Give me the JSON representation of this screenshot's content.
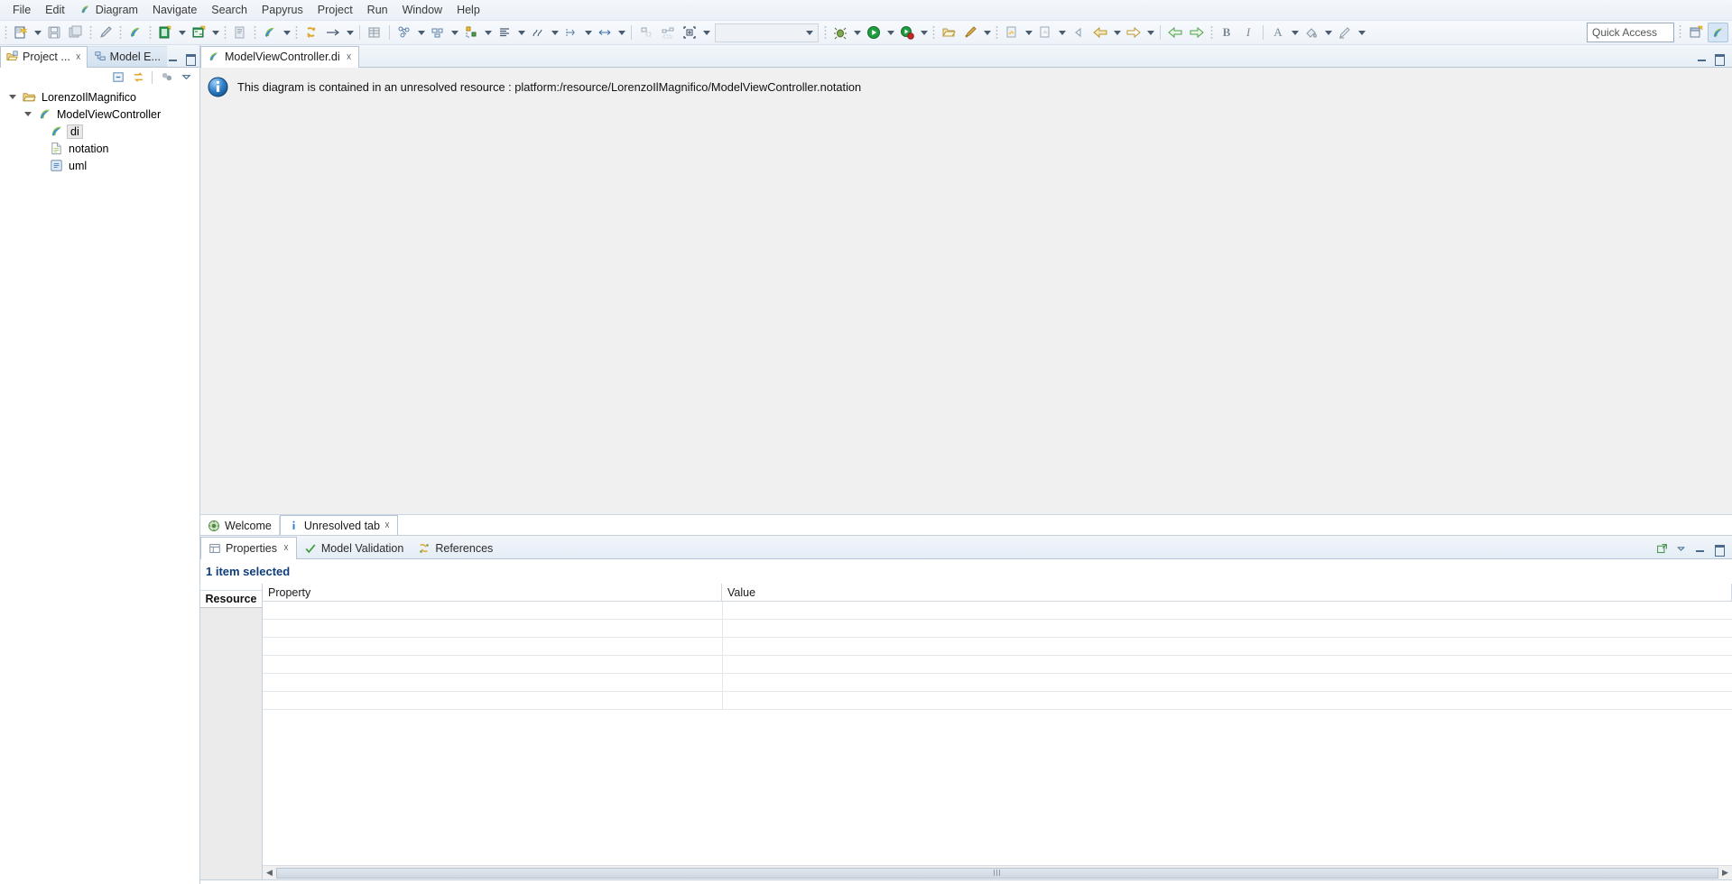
{
  "menubar": {
    "items": [
      {
        "label": "File",
        "icon": null
      },
      {
        "label": "Edit",
        "icon": null
      },
      {
        "label": "Diagram",
        "icon": "papyrus-icon"
      },
      {
        "label": "Navigate",
        "icon": null
      },
      {
        "label": "Search",
        "icon": null
      },
      {
        "label": "Papyrus",
        "icon": null
      },
      {
        "label": "Project",
        "icon": null
      },
      {
        "label": "Run",
        "icon": null
      },
      {
        "label": "Window",
        "icon": null
      },
      {
        "label": "Help",
        "icon": null
      }
    ]
  },
  "toolbar": {
    "quick_access_placeholder": "Quick Access",
    "combo1_value": "",
    "combo2_value": "",
    "buttons": [
      {
        "name": "new-wizard",
        "title": "New"
      },
      {
        "name": "save",
        "title": "Save"
      },
      {
        "name": "save-all",
        "title": "Save All"
      },
      {
        "name": "print",
        "title": "Print"
      },
      {
        "name": "papyrus-perspective",
        "title": "Papyrus"
      },
      {
        "name": "new-model",
        "title": "New Model"
      },
      {
        "name": "new-diagram",
        "title": "New Diagram"
      },
      {
        "name": "paste-style",
        "title": "Copy Style"
      },
      {
        "name": "papyrus-model",
        "title": "Papyrus Model"
      },
      {
        "name": "refresh-link",
        "title": "Refresh"
      },
      {
        "name": "arrow-tool",
        "title": "Arrow"
      },
      {
        "name": "table-tool",
        "title": "Table"
      },
      {
        "name": "filter-nodes",
        "title": "Filter"
      },
      {
        "name": "align-nodes",
        "title": "Align"
      },
      {
        "name": "distribute-nodes",
        "title": "Distribute"
      },
      {
        "name": "align-text",
        "title": "Align Text"
      },
      {
        "name": "route-links",
        "title": "Routing"
      },
      {
        "name": "resize-links",
        "title": "Link Style"
      },
      {
        "name": "snap-size",
        "title": "Size"
      },
      {
        "name": "arrange-selection",
        "title": "Arrange Selection"
      },
      {
        "name": "arrange-all",
        "title": "Arrange All"
      },
      {
        "name": "zoom-fit",
        "title": "Zoom to Fit"
      },
      {
        "name": "debug",
        "title": "Debug"
      },
      {
        "name": "run",
        "title": "Run"
      },
      {
        "name": "coverage",
        "title": "Coverage"
      },
      {
        "name": "open-type",
        "title": "Open Type"
      },
      {
        "name": "search-ref",
        "title": "Search"
      },
      {
        "name": "next-annotation",
        "title": "Next Annotation"
      },
      {
        "name": "last-edit",
        "title": "Last Edit Location"
      },
      {
        "name": "back-nav",
        "title": "Back"
      },
      {
        "name": "forward-nav",
        "title": "Forward"
      },
      {
        "name": "prev-page",
        "title": "Previous"
      },
      {
        "name": "next-page",
        "title": "Next"
      },
      {
        "name": "bold",
        "title": "B"
      },
      {
        "name": "italic",
        "title": "I"
      },
      {
        "name": "font-color",
        "title": "A"
      },
      {
        "name": "fill-color",
        "title": "Fill Color"
      },
      {
        "name": "line-color",
        "title": "Line Color"
      }
    ],
    "format_bold_label": "B",
    "format_italic_label": "I",
    "format_font_label": "A"
  },
  "left_panel": {
    "tabs": [
      {
        "label": "Project ...",
        "icon": "project-explorer-icon",
        "active": true,
        "closable": true
      },
      {
        "label": "Model E...",
        "icon": "model-explorer-icon",
        "active": false,
        "closable": false
      }
    ],
    "view_toolbar": [
      {
        "name": "collapse-all-button",
        "icon": "collapse-all-icon"
      },
      {
        "name": "link-with-editor-button",
        "icon": "link-editor-icon"
      },
      {
        "name": "focus-on-active-task-button",
        "icon": "focus-task-icon"
      },
      {
        "name": "view-menu-button",
        "icon": "view-menu-icon"
      }
    ],
    "tree": [
      {
        "label": "LorenzoIlMagnifico",
        "icon": "project-folder-icon",
        "depth": 0,
        "expanded": true,
        "selected": false
      },
      {
        "label": "ModelViewController",
        "icon": "papyrus-model-icon",
        "depth": 1,
        "expanded": true,
        "selected": false
      },
      {
        "label": "di",
        "icon": "papyrus-di-icon",
        "depth": 2,
        "expanded": null,
        "selected": true
      },
      {
        "label": "notation",
        "icon": "notation-file-icon",
        "depth": 2,
        "expanded": null,
        "selected": false
      },
      {
        "label": "uml",
        "icon": "uml-file-icon",
        "depth": 2,
        "expanded": null,
        "selected": false
      }
    ]
  },
  "editor": {
    "tabs": [
      {
        "label": "ModelViewController.di",
        "icon": "papyrus-icon",
        "active": true,
        "closable": true
      }
    ],
    "notification": {
      "icon": "info-icon",
      "message": "This diagram is contained in an unresolved resource : platform:/resource/LorenzoIlMagnifico/ModelViewController.notation"
    },
    "inner_tabs": [
      {
        "label": "Welcome",
        "icon": "welcome-icon",
        "active": false,
        "closable": false
      },
      {
        "label": "Unresolved tab",
        "icon": "info-small-icon",
        "active": true,
        "closable": true
      }
    ]
  },
  "properties": {
    "tabs": [
      {
        "label": "Properties",
        "icon": "properties-icon",
        "active": true,
        "closable": true
      },
      {
        "label": "Model Validation",
        "icon": "validation-check-icon",
        "active": false,
        "closable": false
      },
      {
        "label": "References",
        "icon": "references-icon",
        "active": false,
        "closable": false
      }
    ],
    "view_controls": [
      {
        "name": "maximize-restore-icon"
      },
      {
        "name": "view-menu-icon"
      },
      {
        "name": "minimize-icon"
      },
      {
        "name": "maximize-icon"
      }
    ],
    "selection_status": "1 item selected",
    "side_tabs": [
      {
        "label": "Resource",
        "active": true
      }
    ],
    "table": {
      "columns": [
        "Property",
        "Value"
      ],
      "rows": [
        {
          "property": "",
          "value": ""
        },
        {
          "property": "",
          "value": ""
        },
        {
          "property": "",
          "value": ""
        },
        {
          "property": "",
          "value": ""
        },
        {
          "property": "",
          "value": ""
        },
        {
          "property": "",
          "value": ""
        }
      ]
    },
    "scroll": {
      "left_arrow": "◀",
      "right_arrow": "▶"
    }
  },
  "colors": {
    "accent_blue": "#0d3d7a",
    "tab_border": "#b6c5d6",
    "editor_bg": "#f0f0f0",
    "toolbar_bg": "#eef3f9"
  }
}
